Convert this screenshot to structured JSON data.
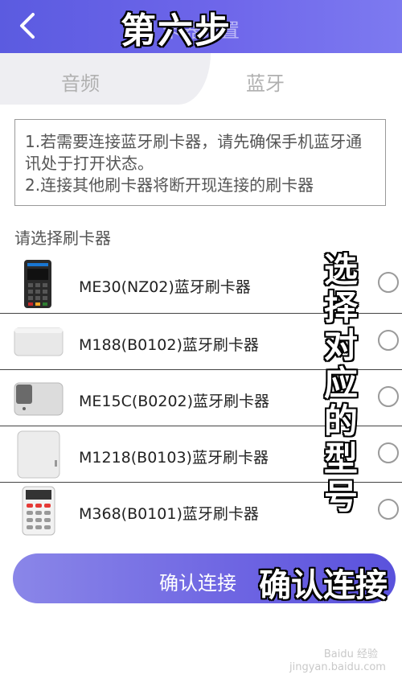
{
  "header": {
    "title": "卡器设置"
  },
  "overlays": {
    "step": "第六步",
    "select_hint": [
      "选",
      "择",
      "对",
      "应",
      "的",
      "型",
      "号"
    ],
    "confirm": "确认连接"
  },
  "tabs": [
    {
      "label": "音频",
      "active": false
    },
    {
      "label": "蓝牙",
      "active": true
    }
  ],
  "notice": {
    "line1": "1.若需要连接蓝牙刷卡器，请先确保手机蓝牙通讯处于打开状态。",
    "line2": "2.连接其他刷卡器将断开现连接的刷卡器"
  },
  "section_title": "请选择刷卡器",
  "readers": [
    {
      "label": "ME30(NZ02)蓝牙刷卡器",
      "selected": false
    },
    {
      "label": "M188(B0102)蓝牙刷卡器",
      "selected": false
    },
    {
      "label": "ME15C(B0202)蓝牙刷卡器",
      "selected": false
    },
    {
      "label": "M1218(B0103)蓝牙刷卡器",
      "selected": false
    },
    {
      "label": "M368(B0101)蓝牙刷卡器",
      "selected": false
    }
  ],
  "confirm_button": "确认连接",
  "watermark": {
    "brand": "Baidu 经验",
    "url": "jingyan.baidu.com"
  },
  "colors": {
    "header": "#5b5be0",
    "button": "#6d64e2"
  }
}
